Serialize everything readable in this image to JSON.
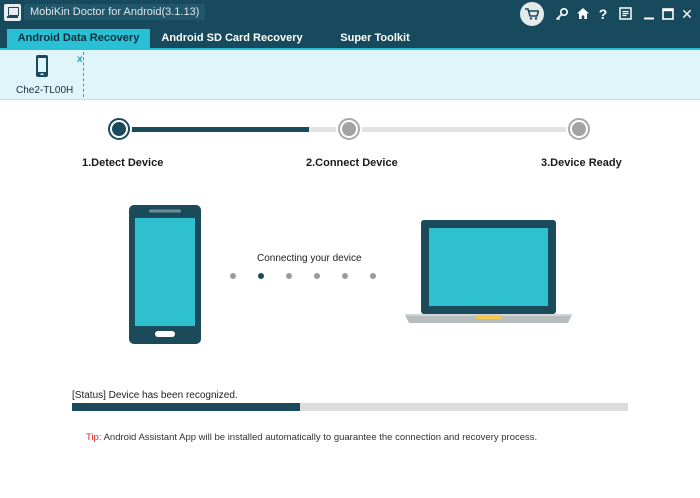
{
  "window": {
    "title": "MobiKin Doctor for Android(3.1.13)"
  },
  "titlebar_icons": [
    "cart-icon",
    "key-icon",
    "home-icon",
    "help-icon",
    "feedback-icon",
    "minimize-icon",
    "maximize-icon",
    "close-icon"
  ],
  "titlebar_glyphs": {
    "help": "?",
    "close": "✕"
  },
  "tabs": [
    {
      "label": "Android Data Recovery",
      "active": true
    },
    {
      "label": "Android SD Card Recovery",
      "active": false
    },
    {
      "label": "Super Toolkit",
      "active": false
    }
  ],
  "device": {
    "name": "Che2-TL00H",
    "close_label": "x"
  },
  "steps": [
    {
      "label": "1.Detect Device",
      "state": "done"
    },
    {
      "label": "2.Connect Device",
      "state": "pending"
    },
    {
      "label": "3.Device Ready",
      "state": "pending"
    }
  ],
  "connection": {
    "message": "Connecting your device",
    "dot_count": 6,
    "active_dot": 1
  },
  "status": {
    "text": "[Status] Device has been recognized.",
    "progress_percent": 41
  },
  "tip": {
    "label": "Tip:",
    "text": " Android Assistant App will be installed automatically to guarantee the connection and recovery process."
  },
  "colors": {
    "primary_dark": "#174a5d",
    "accent": "#29c0d5",
    "screen": "#2fc0cf",
    "tip_red": "#e02424",
    "strip_bg": "#dff5fa"
  }
}
